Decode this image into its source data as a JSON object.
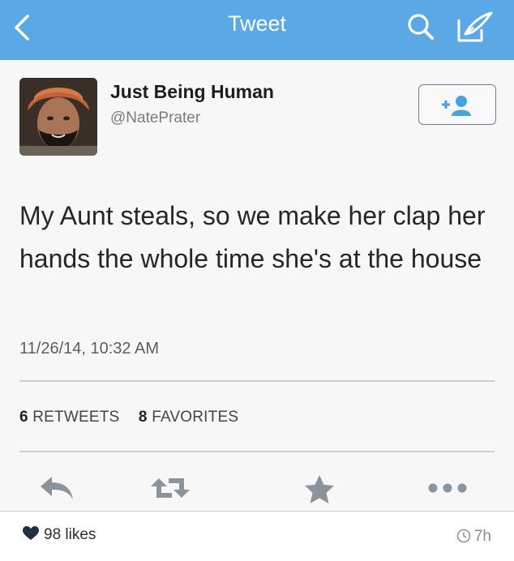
{
  "nav": {
    "title": "Tweet",
    "icons": [
      "chevron-left-icon",
      "search-icon",
      "compose-icon"
    ],
    "bar_color": "#5aa8e6"
  },
  "tweet": {
    "user_name": "Just Being Human",
    "handle": "@NatePrater",
    "text": "My Aunt steals, so we make her clap her hands the whole time she's at the house",
    "timestamp": "11/26/14, 10:32 AM",
    "retweets_count": "6",
    "retweets_label": "RETWEETS",
    "favorites_count": "8",
    "favorites_label": "FAVORITES",
    "follow_icon": "add-user-icon",
    "action_icons": [
      "reply-icon",
      "retweet-icon",
      "favorite-star-icon",
      "more-icon"
    ]
  },
  "footer": {
    "likes": "98 likes",
    "age": "7h",
    "icons": [
      "heart-icon",
      "clock-icon"
    ]
  }
}
